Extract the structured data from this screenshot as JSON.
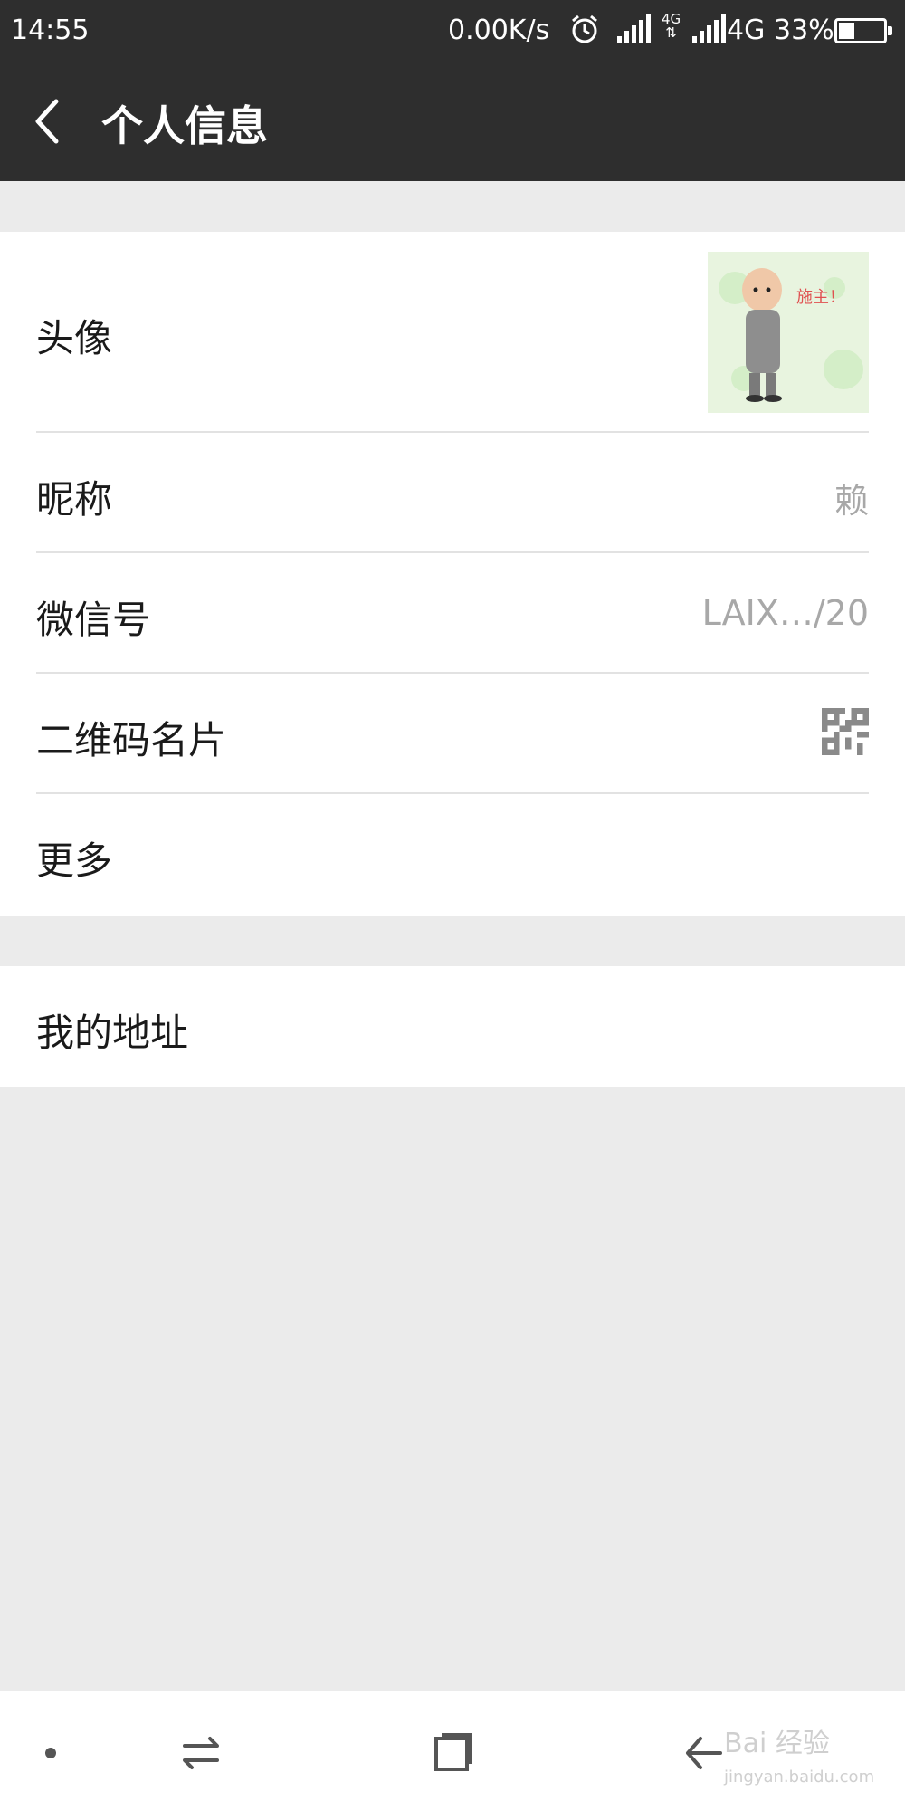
{
  "status_bar": {
    "time": "14:55",
    "speed": "0.00K/s",
    "network_small_top": "4G",
    "network_small_bottom": "⇅",
    "network": "4G",
    "battery_pct_text": "33%",
    "battery_level": 0.33
  },
  "header": {
    "title": "个人信息"
  },
  "profile": {
    "avatar_label": "头像",
    "avatar_caption": "施主！",
    "nickname_label": "昵称",
    "nickname_value": "赖",
    "wechat_id_label": "微信号",
    "wechat_id_value": "LAIX…/20",
    "qr_label": "二维码名片",
    "more_label": "更多"
  },
  "address": {
    "label": "我的地址"
  },
  "icons": {
    "back": "chevron-left-icon",
    "qr": "qr-code-icon",
    "alarm": "alarm-icon",
    "signal": "signal-icon",
    "battery": "battery-icon",
    "nav_dot": "dot-icon",
    "nav_switch": "switch-arrows-icon",
    "nav_home": "square-icon",
    "nav_back": "back-arrow-icon"
  },
  "watermark": {
    "brand": "Bai 经验",
    "url": "jingyan.baidu.com"
  },
  "colors": {
    "header_bg": "#2e2e2e",
    "page_bg": "#ebebeb",
    "row_bg": "#ffffff",
    "value_text": "#a8a8a8"
  }
}
